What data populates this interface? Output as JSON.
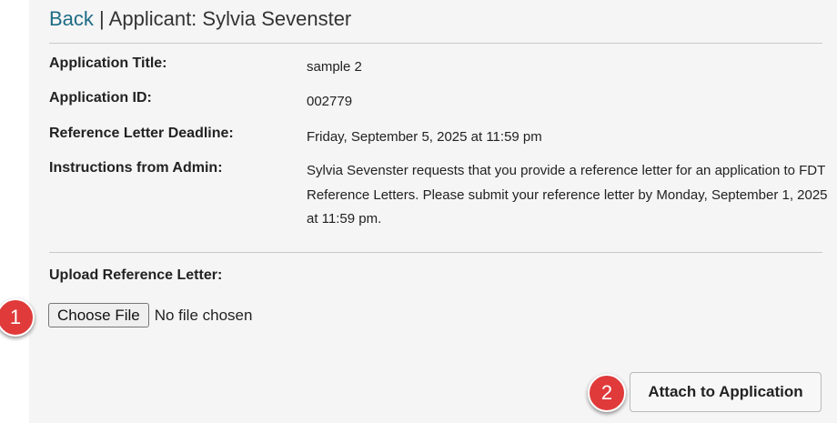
{
  "header": {
    "back_label": "Back",
    "separator": "|",
    "title": "Applicant: Sylvia Sevenster"
  },
  "details": {
    "application_title_label": "Application Title:",
    "application_title_value": "sample 2",
    "application_id_label": "Application ID:",
    "application_id_value": "002779",
    "deadline_label": "Reference Letter Deadline:",
    "deadline_value": "Friday, September 5, 2025 at 11:59 pm",
    "instructions_label": "Instructions from Admin:",
    "instructions_value": "Sylvia Sevenster requests that you provide a reference letter for an application to FDT Reference Letters. Please submit your reference letter by Monday, September 1, 2025 at 11:59 pm."
  },
  "upload": {
    "label": "Upload Reference Letter:",
    "choose_file_label": "Choose File",
    "file_status": "No file chosen"
  },
  "actions": {
    "attach_label": "Attach to Application"
  },
  "markers": {
    "first": "1",
    "second": "2",
    "color": "#e03a3a"
  },
  "colors": {
    "link": "#1e6b86",
    "panel_background": "#f5f5f5"
  }
}
